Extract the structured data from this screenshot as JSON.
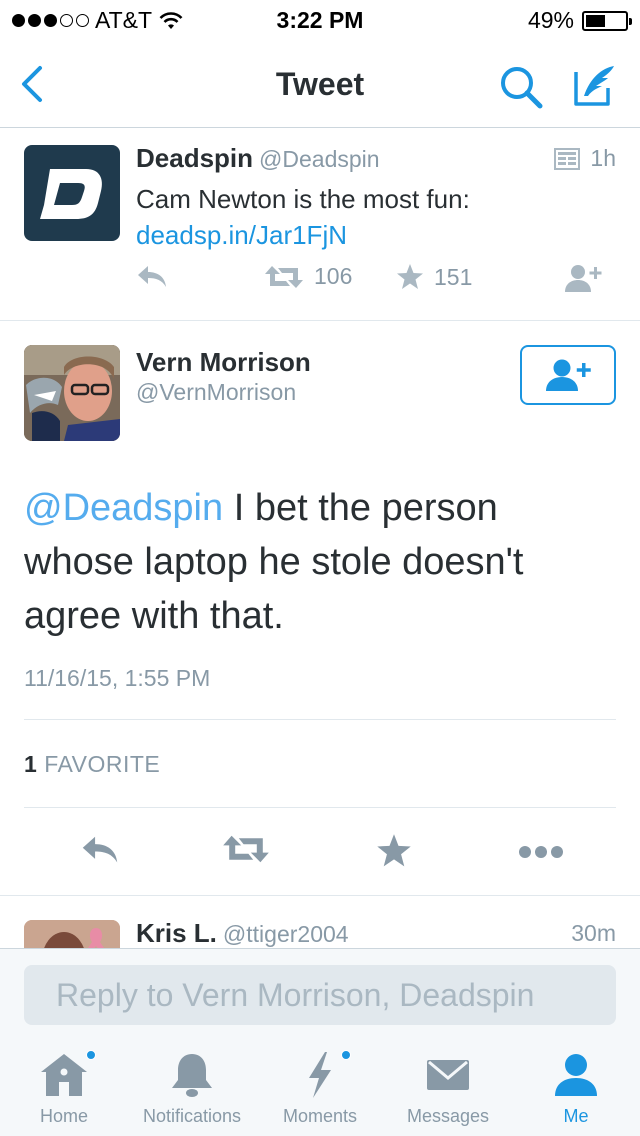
{
  "status_bar": {
    "carrier": "AT&T",
    "signal_bars_filled": 3,
    "signal_bars_total": 5,
    "time": "3:22 PM",
    "battery": "49%",
    "battery_level": 0.49
  },
  "nav": {
    "title": "Tweet"
  },
  "parent_tweet": {
    "name": "Deadspin",
    "handle": "@Deadspin",
    "time": "1h",
    "text": "Cam Newton is the most fun:",
    "link": "deadsp.in/Jar1FjN",
    "retweets": "106",
    "favorites": "151"
  },
  "main_tweet": {
    "name": "Vern Morrison",
    "handle": "@VernMorrison",
    "mention": "@Deadspin",
    "text": " I bet the person whose laptop he stole doesn't agree with that.",
    "date": "11/16/15, 1:55 PM",
    "favorite_count": "1",
    "favorite_label": "FAVORITE"
  },
  "reply_preview": {
    "name": "Kris L.",
    "handle": "@ttiger2004",
    "time": "30m"
  },
  "composer": {
    "placeholder": "Reply to Vern Morrison, Deadspin"
  },
  "tabs": [
    {
      "label": "Home",
      "icon": "home-icon"
    },
    {
      "label": "Notifications",
      "icon": "bell-icon"
    },
    {
      "label": "Moments",
      "icon": "lightning-icon"
    },
    {
      "label": "Messages",
      "icon": "envelope-icon"
    },
    {
      "label": "Me",
      "icon": "person-icon"
    }
  ],
  "colors": {
    "accent": "#1b95e0",
    "mention": "#55acee",
    "muted": "#8899a6",
    "text": "#292f33",
    "deadspin_bg": "#1f3a4d"
  }
}
